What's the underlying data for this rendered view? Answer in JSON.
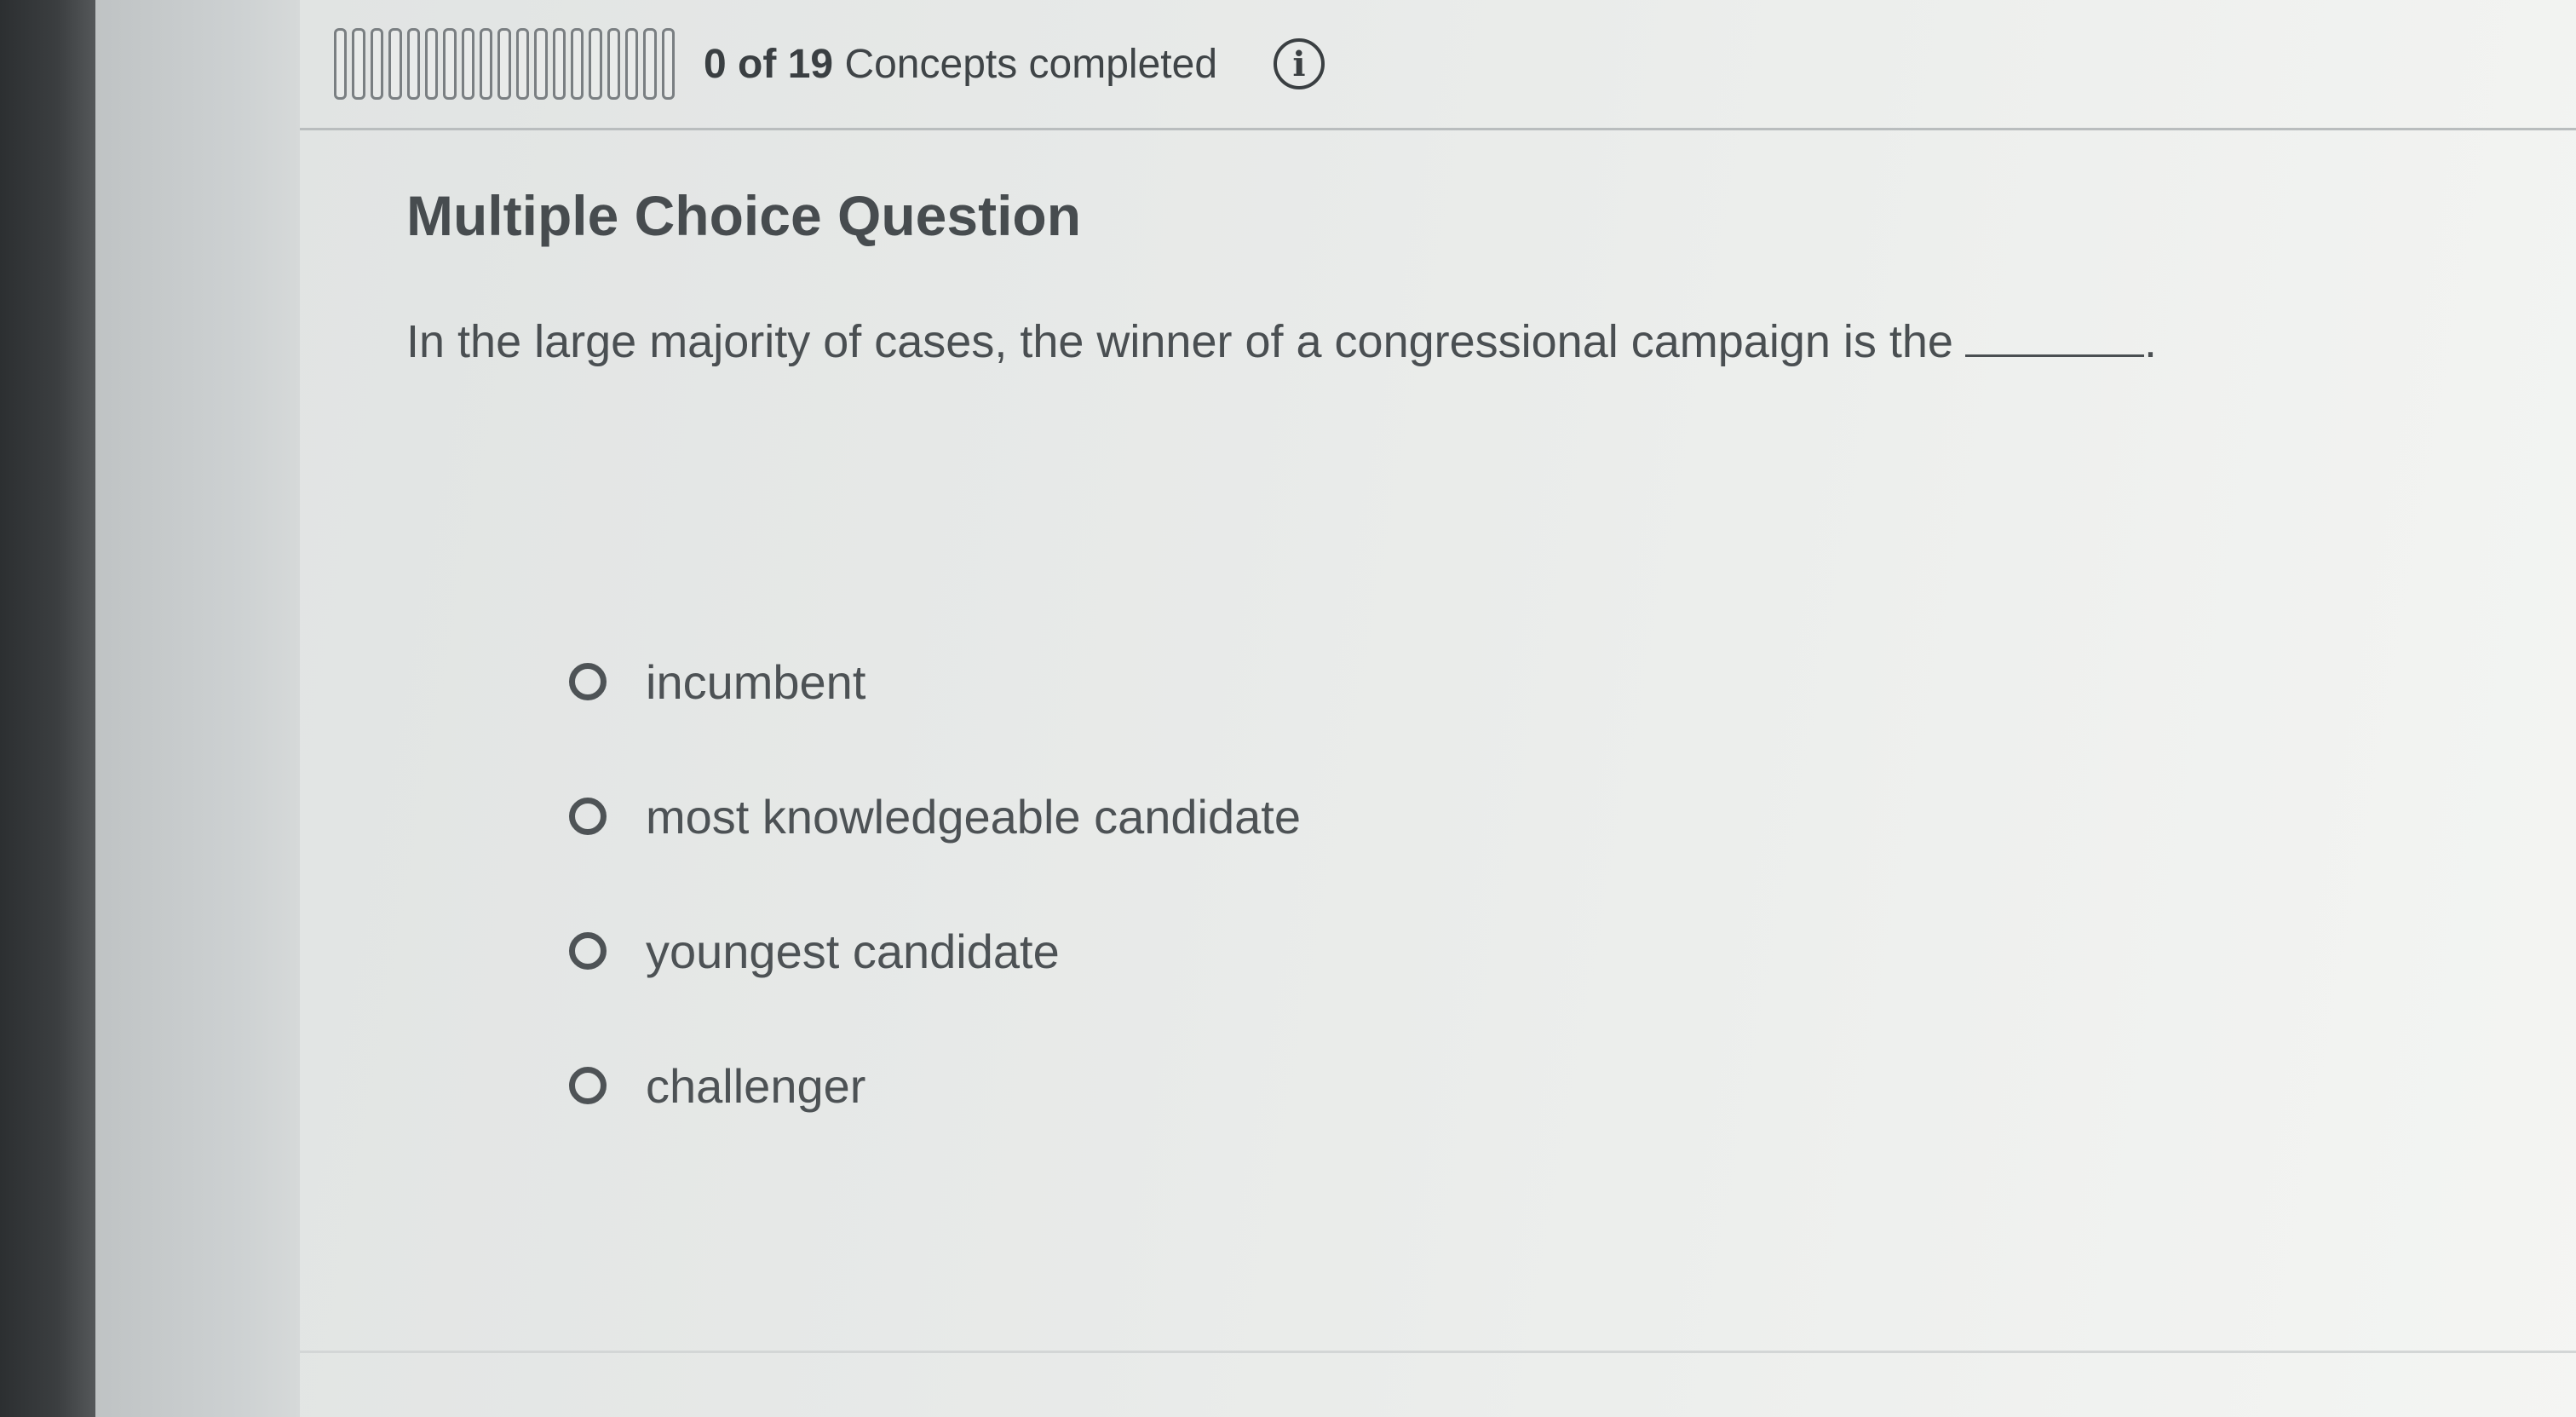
{
  "header": {
    "progress": {
      "completed": 0,
      "total": 19,
      "completed_text": "0",
      "of_text": "of",
      "total_text": "19",
      "label": "Concepts completed"
    },
    "info_icon": "info-icon",
    "info_glyph": "i"
  },
  "question": {
    "title": "Multiple Choice Question",
    "text": "In the large majority of cases, the winner of a congressional campaign is the",
    "text_end": ".",
    "options": [
      {
        "label": "incumbent",
        "selected": false
      },
      {
        "label": "most knowledgeable candidate",
        "selected": false
      },
      {
        "label": "youngest candidate",
        "selected": false
      },
      {
        "label": "challenger",
        "selected": false
      }
    ]
  }
}
